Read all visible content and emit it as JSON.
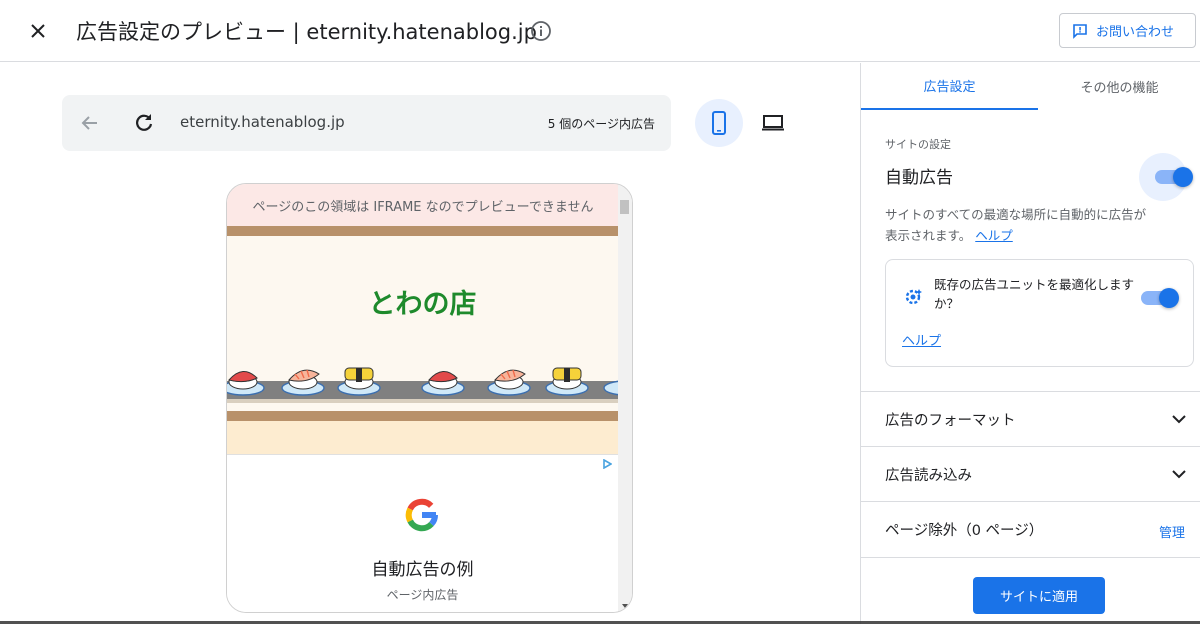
{
  "header": {
    "title": "広告設定のプレビュー | eternity.hatenablog.jp",
    "contact_label": "お問い合わせ"
  },
  "preview": {
    "url": "eternity.hatenablog.jp",
    "ad_count": "5 個のページ内広告",
    "iframe_note": "ページのこの領域は IFRAME なのでプレビューできません",
    "blog_title": "とわの店",
    "ad_example_title": "自動広告の例",
    "ad_example_sub": "ページ内広告"
  },
  "sidebar": {
    "tabs": [
      {
        "label": "広告設定",
        "active": true
      },
      {
        "label": "その他の機能",
        "active": false
      }
    ],
    "section_label": "サイトの設定",
    "auto_ads_label": "自動広告",
    "auto_ads_on": true,
    "auto_ads_desc": "サイトのすべての最適な場所に自動的に広告が表示されます。",
    "help_label": "ヘルプ",
    "optimize_text": "既存の広告ユニットを最適化しますか？",
    "optimize_on": true,
    "optimize_help": "ヘルプ",
    "rows": [
      {
        "label": "広告のフォーマット"
      },
      {
        "label": "広告読み込み"
      },
      {
        "label": "ページ除外（0 ページ）",
        "action": "管理"
      }
    ],
    "apply_label": "サイトに適用"
  },
  "colors": {
    "accent": "#1a73e8",
    "blog_title": "#1e8a2c",
    "iframe_bg": "#fce8e6"
  }
}
